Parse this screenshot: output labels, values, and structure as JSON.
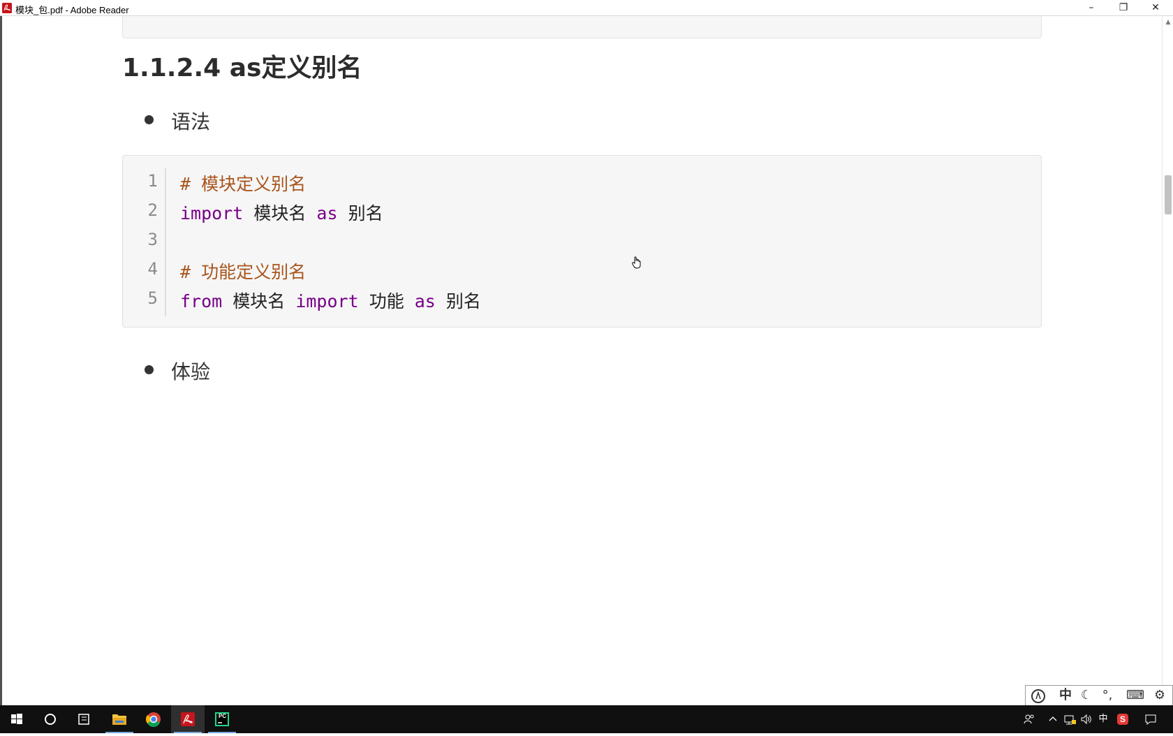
{
  "window": {
    "title": "模块_包.pdf - Adobe Reader",
    "app_icon": "adobe-reader-icon",
    "controls": {
      "minimize": "–",
      "maximize": "❐",
      "close": "✕"
    }
  },
  "document": {
    "heading": "1.1.2.4 as定义别名",
    "bullets": [
      {
        "text": "语法"
      },
      {
        "text": "体验"
      }
    ],
    "code": {
      "line_numbers": [
        "1",
        "2",
        "3",
        "4",
        "5"
      ],
      "lines": [
        [
          {
            "t": "comment",
            "v": "# 模块定义别名"
          }
        ],
        [
          {
            "t": "kw",
            "v": "import"
          },
          {
            "t": "plain",
            "v": " 模块名 "
          },
          {
            "t": "kw",
            "v": "as"
          },
          {
            "t": "plain",
            "v": " 别名"
          }
        ],
        [],
        [
          {
            "t": "comment",
            "v": "# 功能定义别名"
          }
        ],
        [
          {
            "t": "kw",
            "v": "from"
          },
          {
            "t": "plain",
            "v": " 模块名 "
          },
          {
            "t": "kw",
            "v": "import"
          },
          {
            "t": "plain",
            "v": " 功能 "
          },
          {
            "t": "kw",
            "v": "as"
          },
          {
            "t": "plain",
            "v": " 别名"
          }
        ]
      ]
    },
    "colors": {
      "comment": "#a9551c",
      "keyword": "#770088",
      "code_bg": "#f6f6f6"
    }
  },
  "ime": {
    "items": [
      "中",
      "☾",
      "°,",
      "⌨",
      "⚙"
    ],
    "icons": [
      "ime-logo-icon",
      "chinese-mode-icon",
      "moon-icon",
      "punctuation-icon",
      "keyboard-icon",
      "gear-icon"
    ]
  },
  "taskbar": {
    "apps": [
      "windows-start-icon",
      "cortana-search-icon",
      "task-view-icon",
      "file-explorer-icon",
      "chrome-icon",
      "adobe-reader-icon",
      "pycharm-icon"
    ],
    "pycharm_label": "PC",
    "tray": {
      "input_lang": "中",
      "sogou": "S"
    }
  }
}
